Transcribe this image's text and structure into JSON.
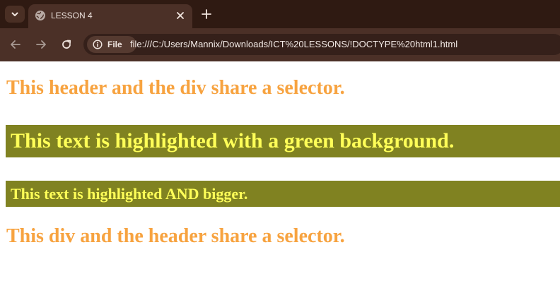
{
  "browser": {
    "tab": {
      "title": "LESSON 4"
    },
    "omnibox": {
      "chip_label": "File",
      "url": "file:///C:/Users/Mannix/Downloads/ICT%20LESSONS/!DOCTYPE%20html1.html"
    },
    "icons": {
      "tab_search": "chevron-down-icon",
      "favicon": "globe-icon",
      "close": "close-icon",
      "new_tab": "plus-icon",
      "back": "arrow-left-icon",
      "forward": "arrow-right-icon",
      "reload": "reload-icon",
      "site_info": "info-icon"
    }
  },
  "page": {
    "header_text": "This header and the div share a selector.",
    "highlight_text": "This text is highlighted with a green background.",
    "highlight_bigger_text": "This text is highlighted AND bigger.",
    "div_text": "This div and the header share a selector."
  },
  "colors": {
    "shared_selector_text": "#f7a340",
    "highlight_background": "#808221",
    "highlight_text": "#ffff58"
  }
}
